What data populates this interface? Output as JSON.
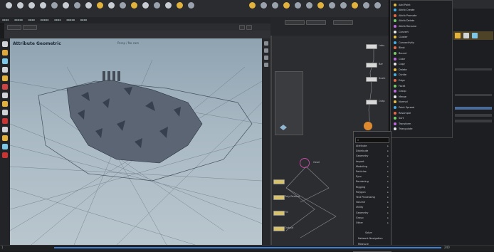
{
  "shelf": {
    "tools": [
      {
        "icon": "box-icon",
        "label": ""
      },
      {
        "icon": "sphere-icon",
        "label": ""
      },
      {
        "icon": "tube-icon",
        "label": ""
      },
      {
        "icon": "torus-icon",
        "label": ""
      },
      {
        "icon": "grid-icon",
        "label": ""
      },
      {
        "icon": "null-icon",
        "label": ""
      },
      {
        "icon": "line-icon",
        "label": ""
      },
      {
        "icon": "circle-icon",
        "label": ""
      },
      {
        "icon": "curve-icon",
        "label": ""
      },
      {
        "icon": "draw-curve-icon",
        "label": ""
      },
      {
        "icon": "path-icon",
        "label": ""
      },
      {
        "icon": "spray-paint-icon",
        "label": ""
      },
      {
        "icon": "font-icon",
        "label": ""
      },
      {
        "icon": "platonic-icon",
        "label": ""
      },
      {
        "icon": "lsystem-icon",
        "label": ""
      },
      {
        "icon": "metaball-icon",
        "label": ""
      },
      {
        "icon": "file-icon",
        "label": ""
      }
    ],
    "colors": {
      "accent": "#e2b23c",
      "bg": "#2a2c2f"
    }
  },
  "viewport": {
    "title": "Attribute Geometric",
    "subtitle": "Persp / No cam"
  },
  "network": {
    "node_labels": [
      "Labs",
      "Bar",
      "Scale",
      "Outp",
      "Geo2",
      "Poly Reduce",
      "Fill",
      "Output"
    ]
  },
  "tab_menu": {
    "search_placeholder": "",
    "items": [
      "Attribute",
      "Distribute",
      "Geometry",
      "Import",
      "Modeling",
      "Particles",
      "Pyro",
      "Rendering",
      "Rigging",
      "Polygon",
      "Text Processing",
      "Volume",
      "Utility",
      "Geometry",
      "Group",
      "Other"
    ],
    "bottom_items": [
      "Solve",
      "Network Navigation",
      "Measure"
    ]
  },
  "right_menu": {
    "items": [
      "Add Point",
      "Attrib Create",
      "Attrib Promote",
      "Attrib Delete",
      "Attrib Rename",
      "Convert",
      "Cluster",
      "Connectivity",
      "Blast",
      "Bound",
      "Color",
      "Copy",
      "Delete",
      "Divide",
      "Edge",
      "Facet",
      "Group",
      "Merge",
      "Normal",
      "Point Spread",
      "Resample",
      "Sort",
      "Transform",
      "Triangulate"
    ],
    "dot_colors": [
      "#e8c040",
      "#44b0e8",
      "#e86a40",
      "#74d066",
      "#c06ae0",
      "#e8e8e8"
    ]
  },
  "timeline": {
    "frame_start": "1",
    "frame_end": "240"
  }
}
